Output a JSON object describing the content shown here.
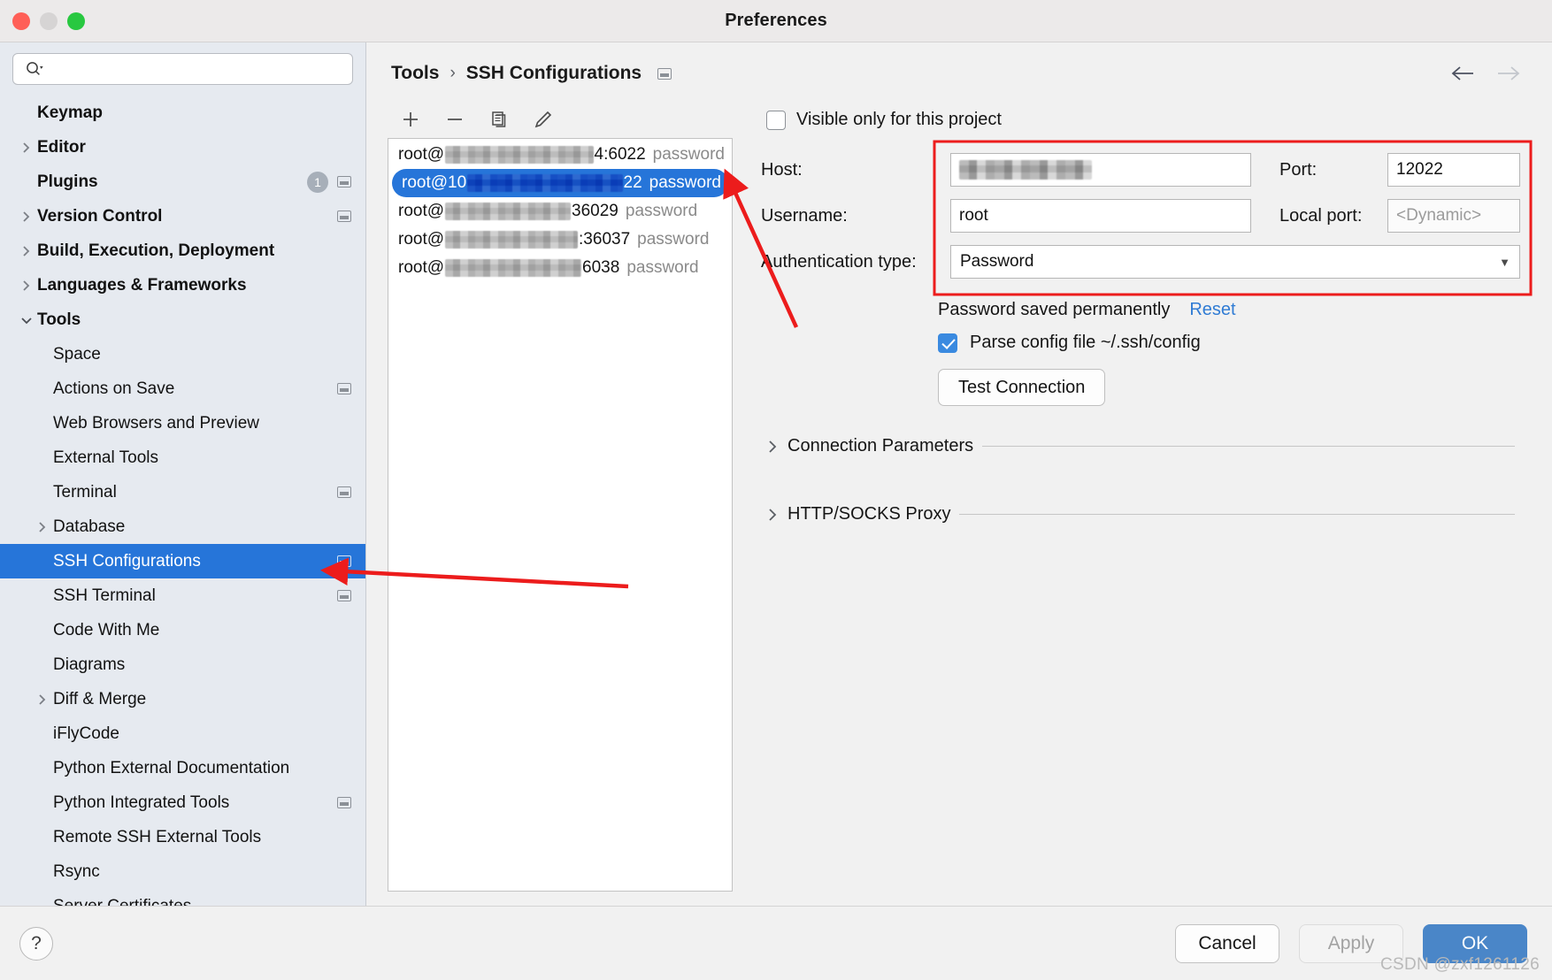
{
  "window": {
    "title": "Preferences",
    "traffic_lights": [
      "close",
      "minimize",
      "zoom"
    ]
  },
  "sidebar": {
    "search": {
      "value": "",
      "placeholder": ""
    },
    "items": [
      {
        "label": "Keymap",
        "level": 0,
        "bold": true,
        "twisty": "none",
        "badge": null,
        "mini_window": false,
        "selected": false
      },
      {
        "label": "Editor",
        "level": 0,
        "bold": true,
        "twisty": "right",
        "badge": null,
        "mini_window": false,
        "selected": false
      },
      {
        "label": "Plugins",
        "level": 0,
        "bold": true,
        "twisty": "none",
        "badge": "1",
        "mini_window": true,
        "selected": false
      },
      {
        "label": "Version Control",
        "level": 0,
        "bold": true,
        "twisty": "right",
        "badge": null,
        "mini_window": true,
        "selected": false
      },
      {
        "label": "Build, Execution, Deployment",
        "level": 0,
        "bold": true,
        "twisty": "right",
        "badge": null,
        "mini_window": false,
        "selected": false
      },
      {
        "label": "Languages & Frameworks",
        "level": 0,
        "bold": true,
        "twisty": "right",
        "badge": null,
        "mini_window": false,
        "selected": false
      },
      {
        "label": "Tools",
        "level": 0,
        "bold": true,
        "twisty": "down",
        "badge": null,
        "mini_window": false,
        "selected": false
      },
      {
        "label": "Space",
        "level": 1,
        "bold": false,
        "twisty": "none",
        "badge": null,
        "mini_window": false,
        "selected": false
      },
      {
        "label": "Actions on Save",
        "level": 1,
        "bold": false,
        "twisty": "none",
        "badge": null,
        "mini_window": true,
        "selected": false
      },
      {
        "label": "Web Browsers and Preview",
        "level": 1,
        "bold": false,
        "twisty": "none",
        "badge": null,
        "mini_window": false,
        "selected": false
      },
      {
        "label": "External Tools",
        "level": 1,
        "bold": false,
        "twisty": "none",
        "badge": null,
        "mini_window": false,
        "selected": false
      },
      {
        "label": "Terminal",
        "level": 1,
        "bold": false,
        "twisty": "none",
        "badge": null,
        "mini_window": true,
        "selected": false
      },
      {
        "label": "Database",
        "level": 1,
        "bold": false,
        "twisty": "right",
        "badge": null,
        "mini_window": false,
        "selected": false
      },
      {
        "label": "SSH Configurations",
        "level": 1,
        "bold": false,
        "twisty": "none",
        "badge": null,
        "mini_window": true,
        "selected": true
      },
      {
        "label": "SSH Terminal",
        "level": 1,
        "bold": false,
        "twisty": "none",
        "badge": null,
        "mini_window": true,
        "selected": false
      },
      {
        "label": "Code With Me",
        "level": 1,
        "bold": false,
        "twisty": "none",
        "badge": null,
        "mini_window": false,
        "selected": false
      },
      {
        "label": "Diagrams",
        "level": 1,
        "bold": false,
        "twisty": "none",
        "badge": null,
        "mini_window": false,
        "selected": false
      },
      {
        "label": "Diff & Merge",
        "level": 1,
        "bold": false,
        "twisty": "right",
        "badge": null,
        "mini_window": false,
        "selected": false
      },
      {
        "label": "iFlyCode",
        "level": 1,
        "bold": false,
        "twisty": "none",
        "badge": null,
        "mini_window": false,
        "selected": false
      },
      {
        "label": "Python External Documentation",
        "level": 1,
        "bold": false,
        "twisty": "none",
        "badge": null,
        "mini_window": false,
        "selected": false
      },
      {
        "label": "Python Integrated Tools",
        "level": 1,
        "bold": false,
        "twisty": "none",
        "badge": null,
        "mini_window": true,
        "selected": false
      },
      {
        "label": "Remote SSH External Tools",
        "level": 1,
        "bold": false,
        "twisty": "none",
        "badge": null,
        "mini_window": false,
        "selected": false
      },
      {
        "label": "Rsync",
        "level": 1,
        "bold": false,
        "twisty": "none",
        "badge": null,
        "mini_window": false,
        "selected": false
      },
      {
        "label": "Server Certificates",
        "level": 1,
        "bold": false,
        "twisty": "none",
        "badge": null,
        "mini_window": false,
        "selected": false
      }
    ]
  },
  "breadcrumb": {
    "parent": "Tools",
    "separator": "›",
    "current": "SSH Configurations"
  },
  "nav": {
    "back": "←",
    "forward": "→",
    "back_enabled": true,
    "forward_enabled": false
  },
  "list_toolbar": {
    "add": "add-icon",
    "remove": "remove-icon",
    "copy": "copy-icon",
    "edit": "pencil-icon"
  },
  "configurations": [
    {
      "user": "root@",
      "host_masked": true,
      "host_width": 196,
      "suffix": "4:6022",
      "auth": "password",
      "selected": false
    },
    {
      "user": "root@10",
      "host_masked": true,
      "host_width": 188,
      "suffix": "22",
      "auth": "password",
      "selected": true
    },
    {
      "user": "root@",
      "host_masked": true,
      "host_width": 142,
      "suffix": "36029",
      "auth": "password",
      "selected": false
    },
    {
      "user": "root@",
      "host_masked": true,
      "host_width": 150,
      "suffix": ":36037",
      "auth": "password",
      "selected": false
    },
    {
      "user": "root@",
      "host_masked": true,
      "host_width": 154,
      "suffix": "6038",
      "auth": "password",
      "selected": false
    }
  ],
  "detail": {
    "visible_only_label": "Visible only for this project",
    "visible_only_checked": false,
    "host_label": "Host:",
    "host_value": "",
    "host_masked": true,
    "port_label": "Port:",
    "port_value": "12022",
    "username_label": "Username:",
    "username_value": "root",
    "local_port_label": "Local port:",
    "local_port_placeholder": "<Dynamic>",
    "auth_type_label": "Authentication type:",
    "auth_type_value": "Password",
    "password_saved_text": "Password saved permanently",
    "reset_link": "Reset",
    "parse_config_label": "Parse config file ~/.ssh/config",
    "parse_config_checked": true,
    "test_connection_label": "Test Connection",
    "sections": [
      {
        "label": "Connection Parameters",
        "expanded": false
      },
      {
        "label": "HTTP/SOCKS Proxy",
        "expanded": false
      }
    ]
  },
  "footer": {
    "help": "?",
    "cancel": "Cancel",
    "apply": "Apply",
    "apply_enabled": false,
    "ok": "OK"
  },
  "watermark": "CSDN @zxf1261126",
  "annotation": {
    "color": "#ec1c1c",
    "highlight_box": "red rectangle around Host/Port/Username/Local port/Authentication type",
    "arrows": 2
  }
}
